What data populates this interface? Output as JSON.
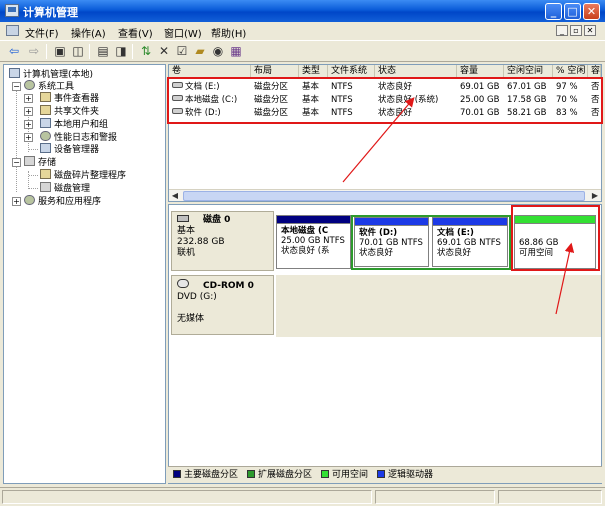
{
  "window": {
    "title": "计算机管理"
  },
  "menu": [
    {
      "label": "文件(F)"
    },
    {
      "label": "操作(A)"
    },
    {
      "label": "查看(V)"
    },
    {
      "label": "窗口(W)"
    },
    {
      "label": "帮助(H)"
    }
  ],
  "tree": {
    "root": "计算机管理(本地)",
    "system_tools": "系统工具",
    "event_viewer": "事件查看器",
    "shared_folders": "共享文件夹",
    "local_users": "本地用户和组",
    "perf_logs": "性能日志和警报",
    "device_manager": "设备管理器",
    "storage": "存储",
    "defrag": "磁盘碎片整理程序",
    "disk_mgmt": "磁盘管理",
    "services": "服务和应用程序"
  },
  "volumes": {
    "columns": [
      "卷",
      "布局",
      "类型",
      "文件系统",
      "状态",
      "容量",
      "空闲空间",
      "% 空闲",
      "容"
    ],
    "rows": [
      [
        "文档 (E:)",
        "磁盘分区",
        "基本",
        "NTFS",
        "状态良好",
        "69.01 GB",
        "67.01 GB",
        "97 %",
        "否"
      ],
      [
        "本地磁盘 (C:)",
        "磁盘分区",
        "基本",
        "NTFS",
        "状态良好 (系统)",
        "25.00 GB",
        "17.58 GB",
        "70 %",
        "否"
      ],
      [
        "软件 (D:)",
        "磁盘分区",
        "基本",
        "NTFS",
        "状态良好",
        "70.01 GB",
        "58.21 GB",
        "83 %",
        "否"
      ]
    ]
  },
  "disk0": {
    "name": "磁盘 0",
    "type": "基本",
    "size": "232.88 GB",
    "status": "联机",
    "partitions": [
      {
        "name": "本地磁盘 (C",
        "size": "25.00 GB NTFS",
        "status": "状态良好 (系"
      },
      {
        "name": "软件 (D:)",
        "size": "70.01 GB NTFS",
        "status": "状态良好"
      },
      {
        "name": "文档 (E:)",
        "size": "69.01 GB NTFS",
        "status": "状态良好"
      },
      {
        "name": "",
        "size": "68.86 GB",
        "status": "可用空间"
      }
    ]
  },
  "cdrom": {
    "name": "CD-ROM 0",
    "type": "DVD (G:)",
    "status": "无媒体"
  },
  "legend": [
    {
      "label": "主要磁盘分区",
      "color": "#000080"
    },
    {
      "label": "扩展磁盘分区",
      "color": "#2D9A2D"
    },
    {
      "label": "可用空间",
      "color": "#33E033"
    },
    {
      "label": "逻辑驱动器",
      "color": "#1C3AE6"
    }
  ],
  "colors": {
    "primary_bar": "#000080",
    "logical_bar": "#1C3AE6",
    "free_bar": "#33E033",
    "extended_border": "#2D9A2D",
    "annotation": "#E01818"
  }
}
